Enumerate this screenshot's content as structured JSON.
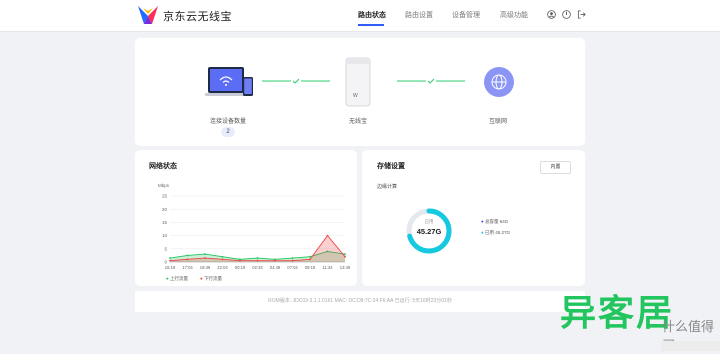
{
  "header": {
    "brand": "京东云无线宝",
    "nav": [
      "路由状态",
      "路由设置",
      "设备管理",
      "高级功能"
    ],
    "active_nav": "路由状态"
  },
  "topology": {
    "devices_label": "连接设备数量",
    "devices_count": "2",
    "router_label": "无线宝",
    "router_logo": "W",
    "internet_label": "互联网"
  },
  "network": {
    "title": "网络状态",
    "unit": "Mbps",
    "legend_up": "上行流量",
    "legend_down": "下行流量"
  },
  "chart_data": {
    "type": "area",
    "title": "网络状态",
    "ylabel": "Mbps",
    "ylim": [
      0,
      25
    ],
    "yticks": [
      0,
      5,
      10,
      15,
      20,
      25
    ],
    "x": [
      "15:19",
      "17:04",
      "19:49",
      "22:04",
      "00:19",
      "02:34",
      "04:49",
      "07:04",
      "09:19",
      "11:34",
      "13:49"
    ],
    "series": [
      {
        "name": "上行流量",
        "color": "#22c55e",
        "values": [
          1.5,
          2.5,
          3,
          2,
          1,
          1.5,
          1,
          1.5,
          2,
          4,
          3
        ]
      },
      {
        "name": "下行流量",
        "color": "#ef4444",
        "values": [
          0.5,
          1,
          1.5,
          1,
          0.5,
          0.5,
          0.5,
          0.5,
          1,
          10,
          2
        ]
      }
    ]
  },
  "storage": {
    "title": "存储设置",
    "button": "内置",
    "section": "边缘计算",
    "center_label": "已用",
    "center_value": "45.27G",
    "total_label": "总容量",
    "total_value": "64G",
    "used_label": "已用",
    "used_value": "45.27G",
    "colors": {
      "total": "#3b4ff5",
      "used": "#15c9e0"
    }
  },
  "footer": {
    "text": "ROM版本: JDC03-3.1.1.0161    MAC: DC:D8:7C:24:F6:AA    已运行: 5天16时23分01秒"
  },
  "watermark": {
    "main": "异客居",
    "sub": "什么值得买"
  }
}
